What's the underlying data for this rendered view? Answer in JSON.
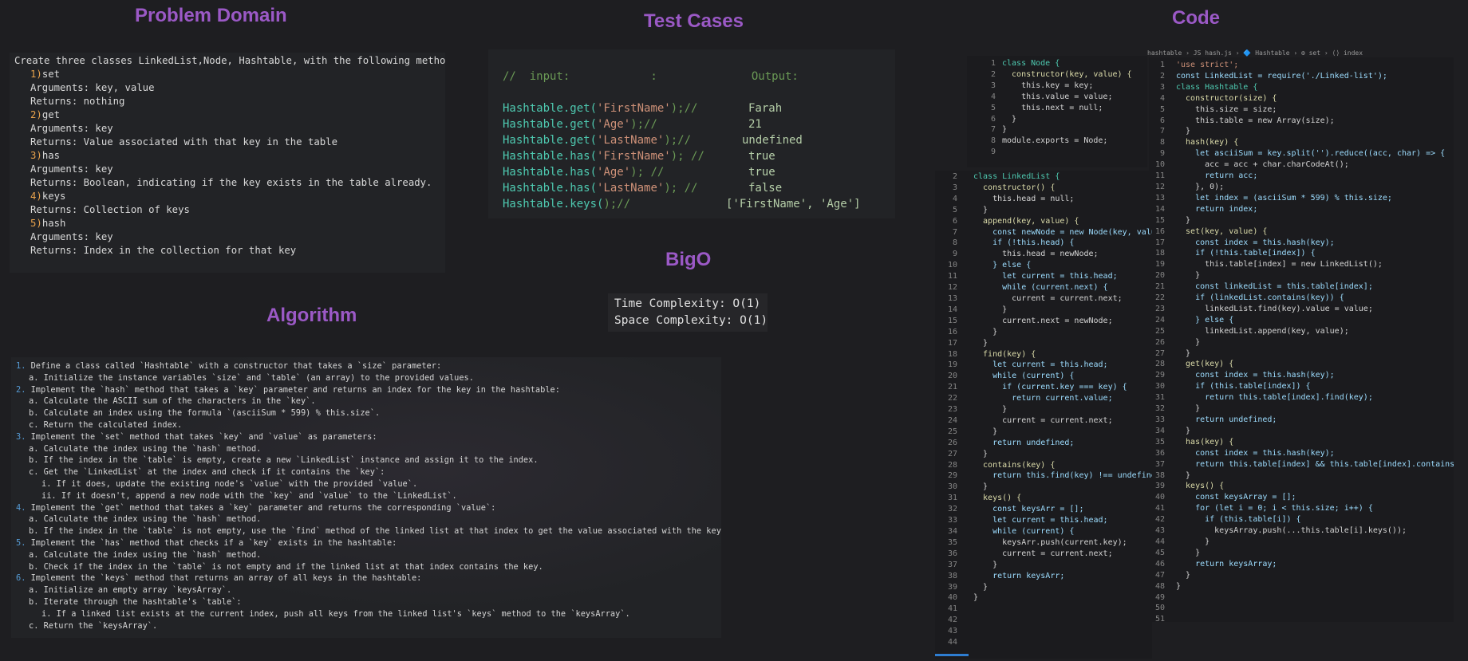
{
  "headings": {
    "problem": "Problem Domain",
    "tests": "Test Cases",
    "code": "Code",
    "bigo": "BigO",
    "algorithm": "Algorithm"
  },
  "problem": {
    "intro": "Create three classes LinkedList,Node, Hashtable, with the following methods:",
    "methods": [
      {
        "num": "1)",
        "name": "set",
        "args": "Arguments: key, value",
        "returns": "Returns: nothing"
      },
      {
        "num": "2)",
        "name": "get",
        "args": "Arguments: key",
        "returns": "Returns: Value associated with that key in the table"
      },
      {
        "num": "3)",
        "name": "has",
        "args": "Arguments: key",
        "returns": "Returns: Boolean, indicating if the key exists in the table already."
      },
      {
        "num": "4)",
        "name": "keys",
        "args": "",
        "returns": "Returns: Collection of keys"
      },
      {
        "num": "5)",
        "name": "hash",
        "args": "Arguments: key",
        "returns": "Returns: Index in the collection for that key"
      }
    ]
  },
  "tests": {
    "header": "//  input:            :              Output:",
    "cases": [
      {
        "pre": "Hashtable.get(",
        "arg": "'FirstName'",
        "post": ");//",
        "out": "Farah"
      },
      {
        "pre": "Hashtable.get(",
        "arg": "'Age'",
        "post": ");//",
        "out": "21"
      },
      {
        "pre": "Hashtable.get(",
        "arg": "'LastName'",
        "post": ");//",
        "out": "undefined"
      },
      {
        "pre": "Hashtable.has(",
        "arg": "'FirstName'",
        "post": "); //",
        "out": "true"
      },
      {
        "pre": "Hashtable.has(",
        "arg": "'Age'",
        "post": "); //",
        "out": "true"
      },
      {
        "pre": "Hashtable.has(",
        "arg": "'LastName'",
        "post": "); //",
        "out": "false"
      },
      {
        "pre": "Hashtable.keys(",
        "arg": "",
        "post": ");//",
        "out": "['FirstName', 'Age']"
      }
    ]
  },
  "bigo": {
    "time": "Time Complexity: O(1)",
    "space": "Space Complexity: O(1)"
  },
  "algorithm": [
    {
      "indent": 0,
      "prefix": "1.",
      "text": "Define a class called `Hashtable` with a constructor that takes a `size` parameter:"
    },
    {
      "indent": 1,
      "prefix": "a.",
      "text": "Initialize the instance variables `size` and `table` (an array) to the provided values."
    },
    {
      "indent": 0,
      "prefix": "2.",
      "text": "Implement the `hash` method that takes a `key` parameter and returns an index for the key in the hashtable:"
    },
    {
      "indent": 1,
      "prefix": "a.",
      "text": "Calculate the ASCII sum of the characters in the `key`."
    },
    {
      "indent": 1,
      "prefix": "b.",
      "text": "Calculate an index using the formula `(asciiSum * 599) % this.size`."
    },
    {
      "indent": 1,
      "prefix": "c.",
      "text": "Return the calculated index."
    },
    {
      "indent": 0,
      "prefix": "3.",
      "text": "Implement the `set` method that takes `key` and `value` as parameters:"
    },
    {
      "indent": 1,
      "prefix": "a.",
      "text": "Calculate the index using the `hash` method."
    },
    {
      "indent": 1,
      "prefix": "b.",
      "text": "If the index in the `table` is empty, create a new `LinkedList` instance and assign it to the index."
    },
    {
      "indent": 1,
      "prefix": "c.",
      "text": "Get the `LinkedList` at the index and check if it contains the `key`:"
    },
    {
      "indent": 2,
      "prefix": "i.",
      "text": "If it does, update the existing node's `value` with the provided `value`."
    },
    {
      "indent": 2,
      "prefix": "ii.",
      "text": "If it doesn't, append a new node with the `key` and `value` to the `LinkedList`."
    },
    {
      "indent": 0,
      "prefix": "4.",
      "text": "Implement the `get` method that takes a `key` parameter and returns the corresponding `value`:"
    },
    {
      "indent": 1,
      "prefix": "a.",
      "text": "Calculate the index using the `hash` method."
    },
    {
      "indent": 1,
      "prefix": "b.",
      "text": "If the index in the `table` is not empty, use the `find` method of the linked list at that index to get the value associated with the key."
    },
    {
      "indent": 0,
      "prefix": "5.",
      "text": "Implement the `has` method that checks if a `key` exists in the hashtable:"
    },
    {
      "indent": 1,
      "prefix": "a.",
      "text": "Calculate the index using the `hash` method."
    },
    {
      "indent": 1,
      "prefix": "b.",
      "text": "Check if the index in the `table` is not empty and if the linked list at that index contains the key."
    },
    {
      "indent": 0,
      "prefix": "6.",
      "text": "Implement the `keys` method that returns an array of all keys in the hashtable:"
    },
    {
      "indent": 1,
      "prefix": "a.",
      "text": "Initialize an empty array `keysArray`."
    },
    {
      "indent": 1,
      "prefix": "b.",
      "text": "Iterate through the hashtable's `table`:"
    },
    {
      "indent": 2,
      "prefix": "i.",
      "text": "If a linked list exists at the current index, push all keys from the linked list's `keys` method to the `keysArray`."
    },
    {
      "indent": 1,
      "prefix": "c.",
      "text": "Return the `keysArray`."
    }
  ],
  "code": {
    "tab_strip": "hashtable ›  JS hash.js › 🔷 Hashtable › ⚙ set › ⟨⟩ index",
    "node": [
      "class Node {",
      "  constructor(key, value) {",
      "    this.key = key;",
      "    this.value = value;",
      "    this.next = null;",
      "  }",
      "}",
      "module.exports = Node;",
      ""
    ],
    "linkedlist": [
      "class LinkedList {",
      "  constructor() {",
      "    this.head = null;",
      "  }",
      "",
      "  append(key, value) {",
      "    const newNode = new Node(key, value);",
      "    if (!this.head) {",
      "      this.head = newNode;",
      "    } else {",
      "      let current = this.head;",
      "      while (current.next) {",
      "        current = current.next;",
      "      }",
      "      current.next = newNode;",
      "    }",
      "  }",
      "",
      "  find(key) {",
      "    let current = this.head;",
      "    while (current) {",
      "      if (current.key === key) {",
      "        return current.value;",
      "      }",
      "      current = current.next;",
      "    }",
      "    return undefined;",
      "  }",
      "",
      "  contains(key) {",
      "    return this.find(key) !== undefined;",
      "  }",
      "",
      "  keys() {",
      "    const keysArr = [];",
      "    let current = this.head;",
      "    while (current) {",
      "      keysArr.push(current.key);",
      "      current = current.next;",
      "    }",
      "    return keysArr;",
      "  }",
      "}"
    ],
    "hashtable": [
      "'use strict';",
      "const LinkedList = require('./Linked-list');",
      "",
      "class Hashtable {",
      "  constructor(size) {",
      "    this.size = size;",
      "    this.table = new Array(size);",
      "  }",
      "",
      "  hash(key) {",
      "    let asciiSum = key.split('').reduce((acc, char) => {",
      "      acc = acc + char.charCodeAt();",
      "      return acc;",
      "    }, 0);",
      "    let index = (asciiSum * 599) % this.size;",
      "    return index;",
      "  }",
      "",
      "  set(key, value) {",
      "    const index = this.hash(key);",
      "    if (!this.table[index]) {",
      "      this.table[index] = new LinkedList();",
      "    }",
      "    const linkedList = this.table[index];",
      "    if (linkedList.contains(key)) {",
      "      linkedList.find(key).value = value;",
      "    } else {",
      "      linkedList.append(key, value);",
      "    }",
      "  }",
      "",
      "  get(key) {",
      "    const index = this.hash(key);",
      "    if (this.table[index]) {",
      "      return this.table[index].find(key);",
      "    }",
      "    return undefined;",
      "  }",
      "",
      "  has(key) {",
      "    const index = this.hash(key);",
      "    return this.table[index] && this.table[index].contains(key);",
      "  }",
      "",
      "  keys() {",
      "    const keysArray = [];",
      "    for (let i = 0; i < this.size; i++) {",
      "      if (this.table[i]) {",
      "        keysArray.push(...this.table[i].keys());",
      "      }",
      "    }",
      "    return keysArray;",
      "  }",
      "}"
    ],
    "ll_start_line": 2,
    "ht_start_line": 1
  }
}
